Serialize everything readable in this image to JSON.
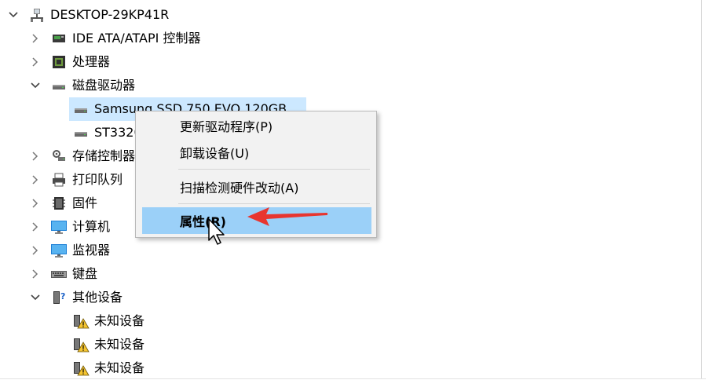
{
  "tree": {
    "root": "DESKTOP-29KP41R",
    "items": [
      {
        "label": "IDE ATA/ATAPI 控制器",
        "icon": "ide-controller-icon",
        "expanded": false
      },
      {
        "label": "处理器",
        "icon": "processor-icon",
        "expanded": false
      },
      {
        "label": "磁盘驱动器",
        "icon": "disk-drive-icon",
        "expanded": true,
        "children": [
          {
            "label": "Samsung SSD 750 EVO 120GB",
            "icon": "disk-drive-icon",
            "selected": true
          },
          {
            "label": "ST3320418AS",
            "icon": "disk-drive-icon"
          }
        ]
      },
      {
        "label": "存储控制器",
        "icon": "storage-controller-icon",
        "expanded": false
      },
      {
        "label": "打印队列",
        "icon": "printer-icon",
        "expanded": false
      },
      {
        "label": "固件",
        "icon": "firmware-icon",
        "expanded": false
      },
      {
        "label": "计算机",
        "icon": "computer-icon",
        "expanded": false
      },
      {
        "label": "监视器",
        "icon": "monitor-icon",
        "expanded": false
      },
      {
        "label": "键盘",
        "icon": "keyboard-icon",
        "expanded": false
      },
      {
        "label": "其他设备",
        "icon": "other-devices-icon",
        "expanded": true,
        "children": [
          {
            "label": "未知设备",
            "icon": "unknown-device-warning-icon"
          },
          {
            "label": "未知设备",
            "icon": "unknown-device-warning-icon"
          },
          {
            "label": "未知设备",
            "icon": "unknown-device-warning-icon"
          }
        ]
      }
    ]
  },
  "context_menu": {
    "items": [
      {
        "label": "更新驱动程序(P)"
      },
      {
        "label": "卸载设备(U)"
      },
      {
        "label": "扫描检测硬件改动(A)"
      },
      {
        "label": "属性(R)",
        "highlighted": true
      }
    ]
  },
  "colors": {
    "selection": "#cce8ff",
    "menu_highlight": "#9bd0f8",
    "annotation_arrow": "#e8352f"
  }
}
